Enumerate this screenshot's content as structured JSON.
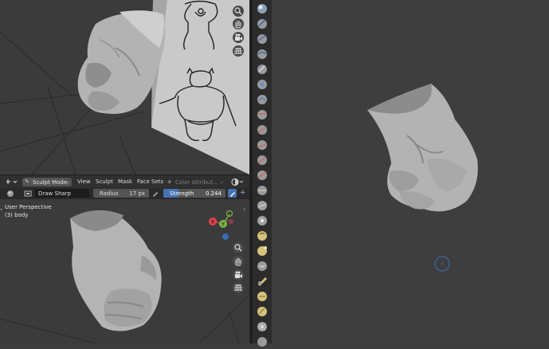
{
  "header": {
    "mode_label": "Sculpt Mode",
    "menus": [
      "View",
      "Sculpt",
      "Mask",
      "Face Sets"
    ],
    "color_attribute": "Color Attribut..."
  },
  "tool_settings": {
    "brush_name": "Draw Sharp",
    "radius_label": "Radius",
    "radius_value": "17 px",
    "strength_label": "Strength",
    "strength_value": "0.244",
    "strength_fraction": 0.244
  },
  "viewport": {
    "perspective": "User Perspective",
    "object": "(3) body"
  },
  "gizmo": {
    "x_label": "X",
    "y_label": "Y",
    "x_color": "#e0434f",
    "y_color": "#7cb342",
    "z_color": "#3b78d8"
  },
  "icons": [
    "zoom-icon",
    "hand-icon",
    "camera-icon",
    "grid-icon"
  ],
  "colors": {
    "accent": "#4772b3",
    "header": "#303030",
    "viewport": "#3b3b3b"
  }
}
